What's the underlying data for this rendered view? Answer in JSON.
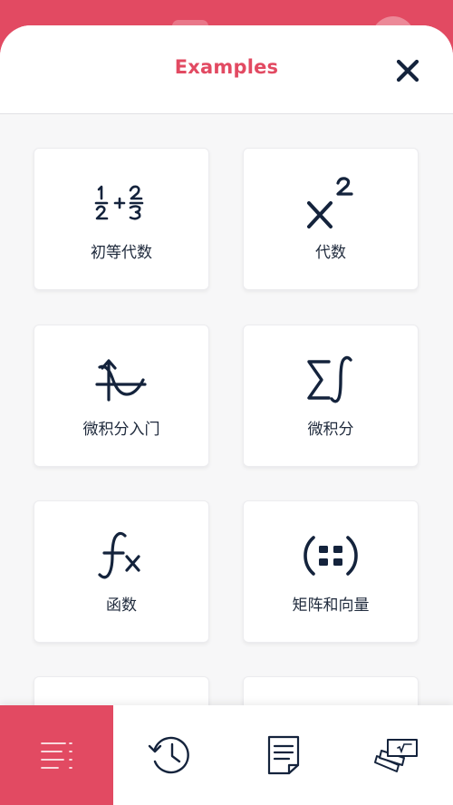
{
  "colors": {
    "accent": "#e24a62",
    "text": "#1f2a3c",
    "sheet_background": "#f7f7f8",
    "card_background": "#ffffff"
  },
  "header": {
    "title": "Examples",
    "close_icon": "close-icon"
  },
  "categories": [
    {
      "label": "初等代数",
      "icon": "fraction-addition-icon"
    },
    {
      "label": "代数",
      "icon": "x-squared-icon"
    },
    {
      "label": "微积分入门",
      "icon": "function-graph-icon"
    },
    {
      "label": "微积分",
      "icon": "sum-integral-icon"
    },
    {
      "label": "函数",
      "icon": "fx-icon"
    },
    {
      "label": "矩阵和向量",
      "icon": "matrix-icon"
    }
  ],
  "tabbar": {
    "active_index": 0,
    "tabs": [
      {
        "icon": "examples-list-icon"
      },
      {
        "icon": "history-clock-icon"
      },
      {
        "icon": "notes-document-icon"
      },
      {
        "icon": "flashcards-icon"
      }
    ]
  }
}
